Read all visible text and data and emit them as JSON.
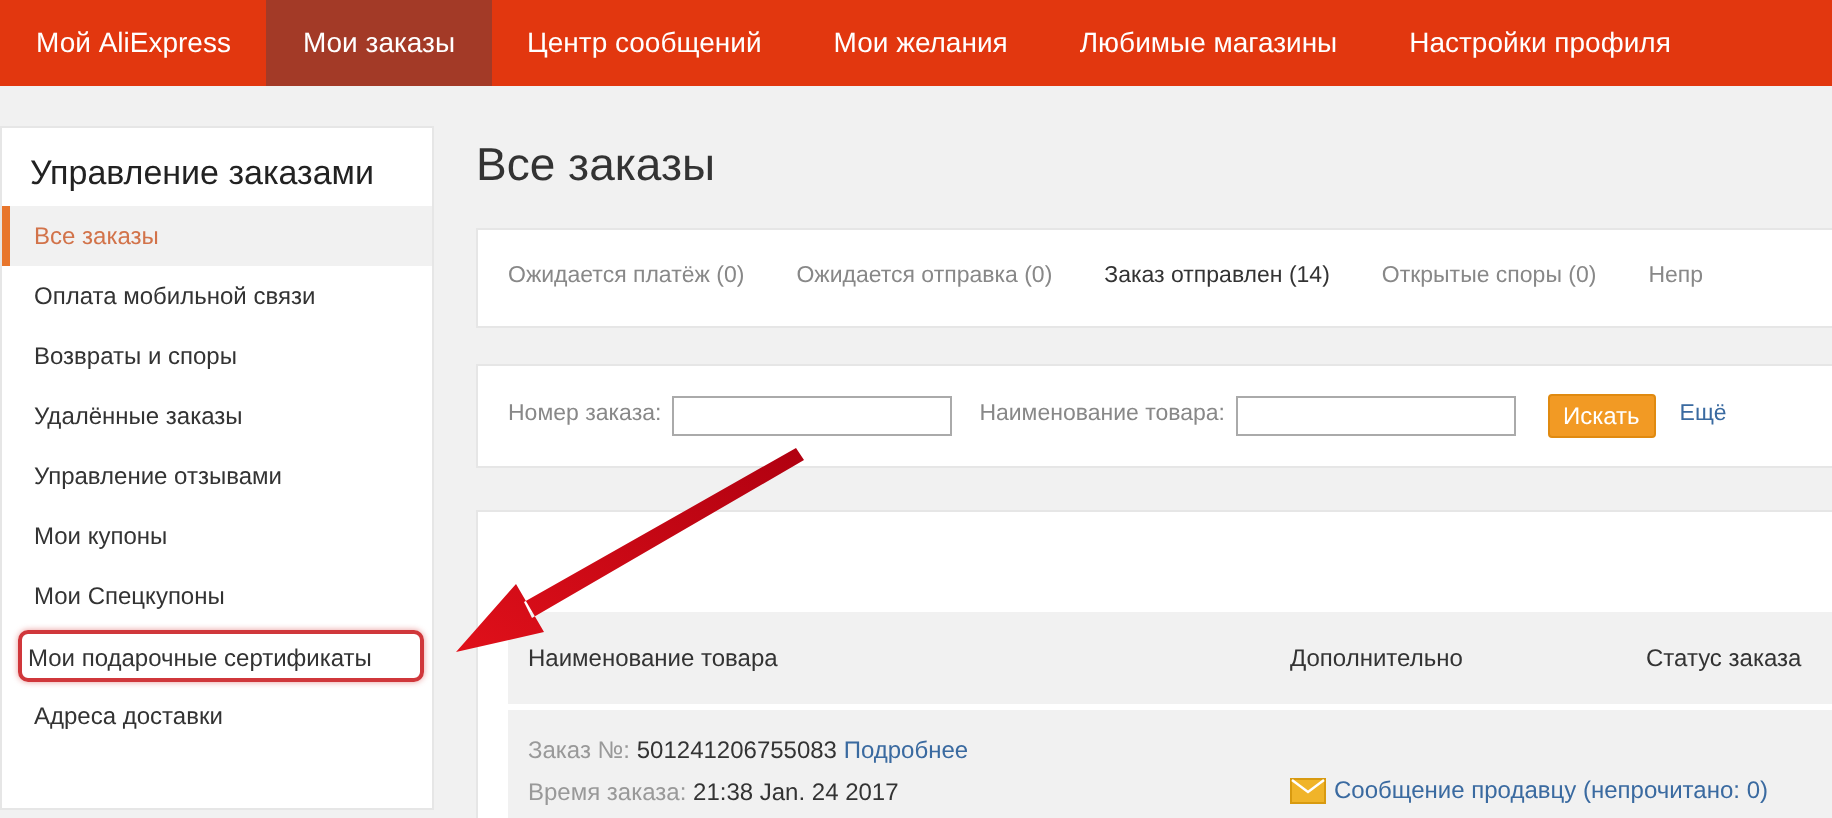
{
  "top_nav": [
    {
      "label": "Мой AliExpress",
      "selected": false
    },
    {
      "label": "Мои заказы",
      "selected": true
    },
    {
      "label": "Центр сообщений",
      "selected": false
    },
    {
      "label": "Мои желания",
      "selected": false
    },
    {
      "label": "Любимые магазины",
      "selected": false
    },
    {
      "label": "Настройки профиля",
      "selected": false
    }
  ],
  "sidebar": {
    "title": "Управление заказами",
    "items": [
      {
        "label": "Все заказы",
        "selected": true,
        "highlighted": false
      },
      {
        "label": "Оплата мобильной связи",
        "selected": false,
        "highlighted": false
      },
      {
        "label": "Возвраты и споры",
        "selected": false,
        "highlighted": false
      },
      {
        "label": "Удалённые заказы",
        "selected": false,
        "highlighted": false
      },
      {
        "label": "Управление отзывами",
        "selected": false,
        "highlighted": false
      },
      {
        "label": "Мои купоны",
        "selected": false,
        "highlighted": false
      },
      {
        "label": "Мои Спецкупоны",
        "selected": false,
        "highlighted": false
      },
      {
        "label": "Мои подарочные сертификаты",
        "selected": false,
        "highlighted": true
      },
      {
        "label": "Адреса доставки",
        "selected": false,
        "highlighted": false
      }
    ]
  },
  "page_title": "Все заказы",
  "status_tabs": [
    {
      "label": "Ожидается платёж (0)",
      "selected": false
    },
    {
      "label": "Ожидается отправка (0)",
      "selected": false
    },
    {
      "label": "Заказ отправлен (14)",
      "selected": true
    },
    {
      "label": "Открытые споры (0)",
      "selected": false
    },
    {
      "label": "Непр",
      "selected": false
    }
  ],
  "search": {
    "order_label": "Номер заказа:",
    "product_label": "Наименование товара:",
    "button": "Искать",
    "more_link": "Ещё"
  },
  "table": {
    "columns": [
      "Наименование товара",
      "Дополнительно",
      "Статус заказа"
    ],
    "rows": [
      {
        "order_label": "Заказ №:",
        "order_number": "501241206755083",
        "details_link": "Подробнее",
        "time_label": "Время заказа:",
        "time": "21:38 Jan. 24 2017",
        "message_link": "Сообщение продавцу (непрочитано: 0)"
      }
    ]
  }
}
